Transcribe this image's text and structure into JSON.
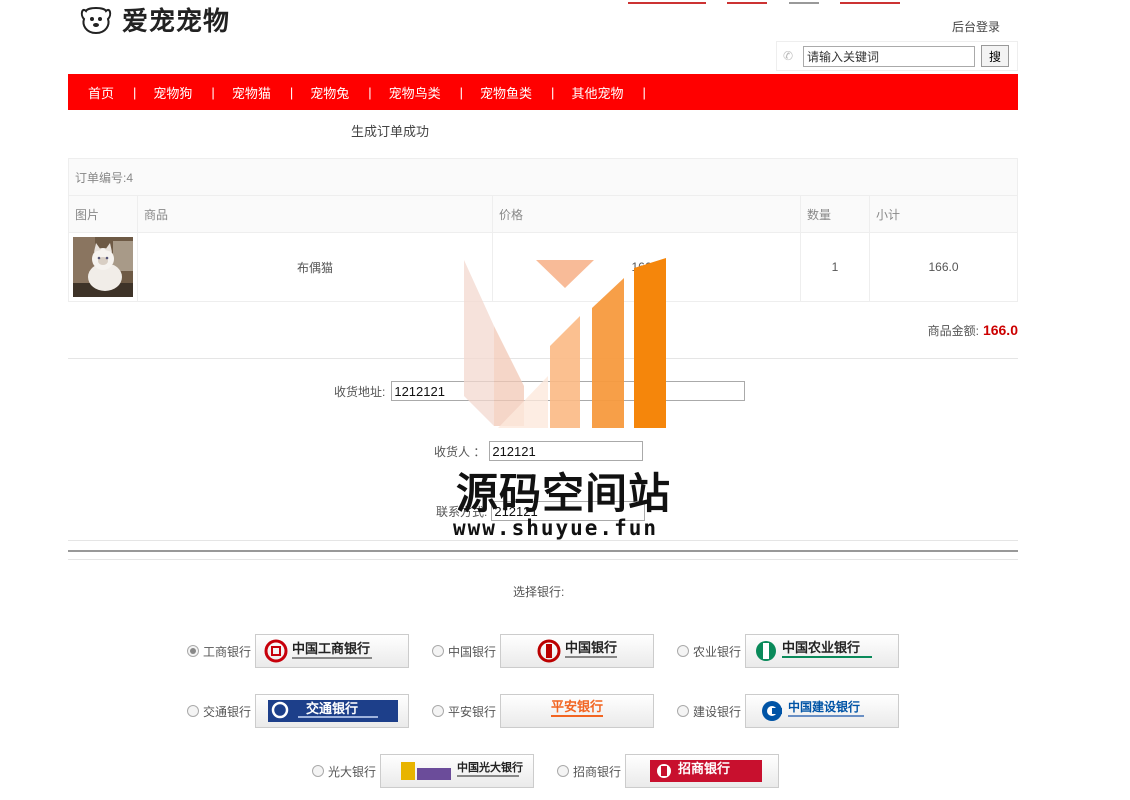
{
  "header": {
    "brand": "爱宠宠物",
    "admin_login": "后台登录",
    "search_placeholder": "请输入关键词",
    "search_button": "搜"
  },
  "nav": {
    "items": [
      "首页",
      "宠物狗",
      "宠物猫",
      "宠物兔",
      "宠物鸟类",
      "宠物鱼类",
      "其他宠物"
    ],
    "separator": "|"
  },
  "order": {
    "success_message": "生成订单成功",
    "order_number_label": "订单编号:4",
    "headers": [
      "图片",
      "商品",
      "价格",
      "数量",
      "小计"
    ],
    "items": [
      {
        "name": "布偶猫",
        "price": "166.0",
        "quantity": "1",
        "subtotal": "166.0"
      }
    ],
    "total_label": "商品金额:",
    "total_value": "166.0"
  },
  "form": {
    "address_label": "收货地址:",
    "address_value": "1212121",
    "receiver_label": "收货人 ：",
    "receiver_value": "212121",
    "phone_label": "联系方式:",
    "phone_value": "212121"
  },
  "bank_select_label": "选择银行:",
  "banks": [
    {
      "name": "工商银行",
      "logo_text": "中国工商银行",
      "selected": true
    },
    {
      "name": "中国银行",
      "logo_text": "中国银行"
    },
    {
      "name": "农业银行",
      "logo_text": "中国农业银行"
    },
    {
      "name": "交通银行",
      "logo_text": "交通银行"
    },
    {
      "name": "平安银行",
      "logo_text": "平安银行"
    },
    {
      "name": "建设银行",
      "logo_text": "中国建设银行"
    },
    {
      "name": "光大银行",
      "logo_text": "中国光大银行"
    },
    {
      "name": "招商银行",
      "logo_text": "招商银行"
    }
  ],
  "watermark": {
    "title": "源码空间站",
    "url": "www.shuyue.fun"
  },
  "colors": {
    "nav_bg": "#ff0000",
    "price_red": "#cc0000",
    "wm_orange": "#f5860b"
  }
}
